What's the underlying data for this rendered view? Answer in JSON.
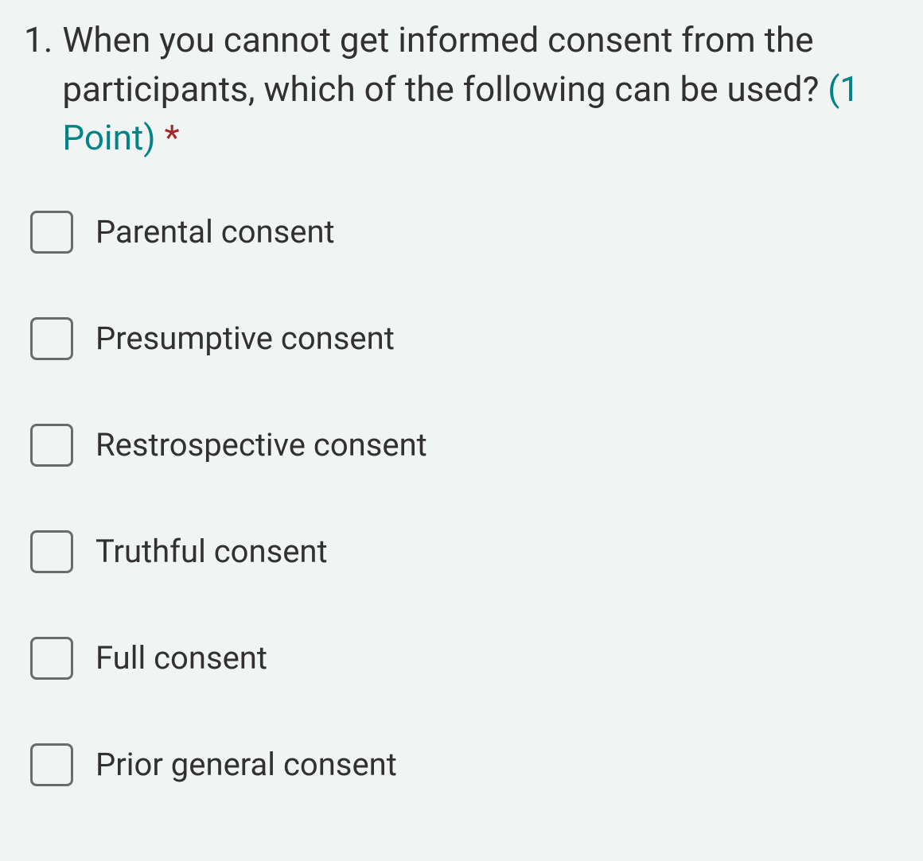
{
  "question": {
    "number": "1.",
    "text": "When you cannot get informed consent from the participants, which of the following can be used?",
    "points_label": "(1 Point)",
    "required_marker": "*"
  },
  "options": [
    {
      "label": "Parental consent"
    },
    {
      "label": "Presumptive consent"
    },
    {
      "label": "Restrospective consent"
    },
    {
      "label": "Truthful consent"
    },
    {
      "label": "Full consent"
    },
    {
      "label": "Prior general consent"
    }
  ]
}
